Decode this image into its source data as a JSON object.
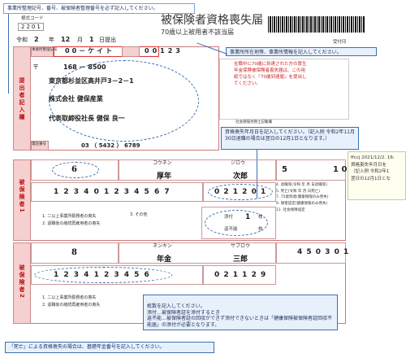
{
  "form": {
    "title": "被保険者資格喪失届",
    "subtitle": "70歳以上被用者不該当届",
    "form_code_label": "様式コード",
    "form_code": "2201",
    "date_prefix": "令和",
    "date_year": "2",
    "date_year_unit": "年",
    "date_month": "12",
    "date_month_unit": "月",
    "date_day": "1",
    "date_day_unit": "日提出",
    "received_stamp": "受付印",
    "office_code_digits": "00－ケイト",
    "office_number": "00123",
    "office_code_label": "事業所整理記号",
    "office_number_label": "事業所番号",
    "postal_mark": "〒",
    "postal_code": "168 － 8500",
    "address": "東京都杉並区高井戸3－2－1",
    "company": "株式会社 健保産業",
    "representative": "代表取締役社長 健保 良一",
    "phone_label": "電話番号",
    "phone": "03 （ 5432 ） 6789",
    "submitter_section": "提出者記入欄",
    "labor_consultant": "社会保険労務士記載欄",
    "red_notice": "在職中に70歳に到達された方の厚生年金保険被保険者喪失届は、この用紙ではなく『70歳到達届』を提出してください。"
  },
  "insured_1": {
    "section_label": "被保険者1",
    "seq": "6",
    "name_kana_sei": "コウネン",
    "name_kana_mei": "ジロウ",
    "name_sei": "厚年",
    "name_mei": "次郎",
    "era_code": "5",
    "birth_partial": "1 0",
    "personal_number": "1 2 3 4 0 1 2 3 4 5 6 7",
    "loss_date": "0 2 1 2 0 1",
    "count_label": "添付",
    "count_value": "1",
    "count_unit": "枚",
    "return_label": "返不能",
    "return_unit": "枚"
  },
  "insured_2": {
    "section_label": "被保険者2",
    "seq": "8",
    "name_kana_sei": "ネンキン",
    "name_kana_mei": "サブロウ",
    "name_sei": "年金",
    "name_mei": "三郎",
    "birth": "4 5 0 3 0 1",
    "personal_number": "1 2 3 4 1 2 3 4 5 6",
    "loss_date": "0 2 1 1 2 9"
  },
  "reason_options": {
    "opt1": "4. 退職等(令和 年 月 日退職等)",
    "opt2": "5. 死亡(令和 年 月 日死亡)",
    "opt3": "7. 75歳到達(健康保険のみ喪失)",
    "opt4": "9. 障害認定(健康保険のみ喪失)",
    "opt5": "11. 社会保障協定"
  },
  "side_notes": {
    "note1": "1. 二以上事業所勤務者の喪失",
    "note2": "2. 退職後の継続再雇用者の喪失",
    "note3": "3. その他"
  },
  "callouts": {
    "top": "事業所整理記号、番号、被保険者整理番号を必ず記入してください。",
    "address": "事業所所在地等、事業所情報を記入してください。",
    "loss_date": "資格喪失年月日を記入してください。（記入例 令和2年11月30日退職の場合は翌日の12月1日となります。）",
    "count": "枚数を記入してください。\n添付…被保険者証を添付するとき\n返不能…被保険者証の回収ができず添付できないときは「健康保険被保険者証回収不能届」の添付が必要となります。",
    "bottom": "「死亡」による資格喪失の場合は、基礎年金番号を記入してください。"
  },
  "comment": {
    "author": "ffccj",
    "date": "2021/12/2. 16:",
    "text_line1": "資格喪失年月日を",
    "text_line2": "（記入例 令和2年1",
    "text_line3": "翌日の12月1日とな"
  }
}
